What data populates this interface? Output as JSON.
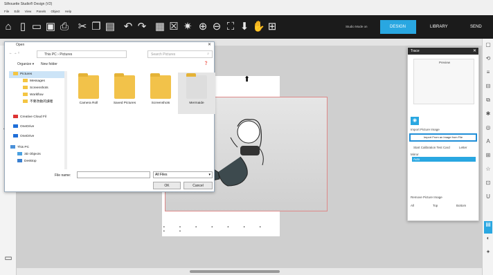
{
  "window": {
    "title": "Silhouette Studio® Design (V2)"
  },
  "menu": [
    "File",
    "Edit",
    "View",
    "Panels",
    "Object",
    "Help"
  ],
  "topnav": {
    "toggle_label": "Studio Mode on",
    "design": "DESIGN",
    "library": "LIBRARY",
    "send": "SEND"
  },
  "dialog": {
    "title": "Open",
    "breadcrumb": "This PC  ›  Pictures",
    "search_placeholder": "Search Pictures",
    "organize": "Organize ▾",
    "new_folder": "New folder",
    "tree": [
      "Pictures",
      "Messages",
      "Screenshots",
      "Workflow",
      "不要改動的讀者",
      "Creative Cloud Fil",
      "OneDrive",
      "OneDrive",
      "This PC",
      "3D Objects",
      "Desktop"
    ],
    "files": [
      "Camera Roll",
      "Saved Pictures",
      "Screenshots",
      "Mermaide"
    ],
    "file_name_label": "File name:",
    "file_type": "All Files",
    "ok": "OK",
    "cancel": "Cancel"
  },
  "trace": {
    "title": "Trace",
    "preview_label": "Preview",
    "section_label": "Import Picture Image",
    "import_btn": "Import From an Image from File",
    "calib": "Start Calibration Test Card",
    "letter": "Letter",
    "filter_label": "Mirror",
    "filter_val": "Auto",
    "remove_label": "Remove Picture Image",
    "opt1": "All",
    "opt2": "Top",
    "opt3": "Bottom"
  }
}
